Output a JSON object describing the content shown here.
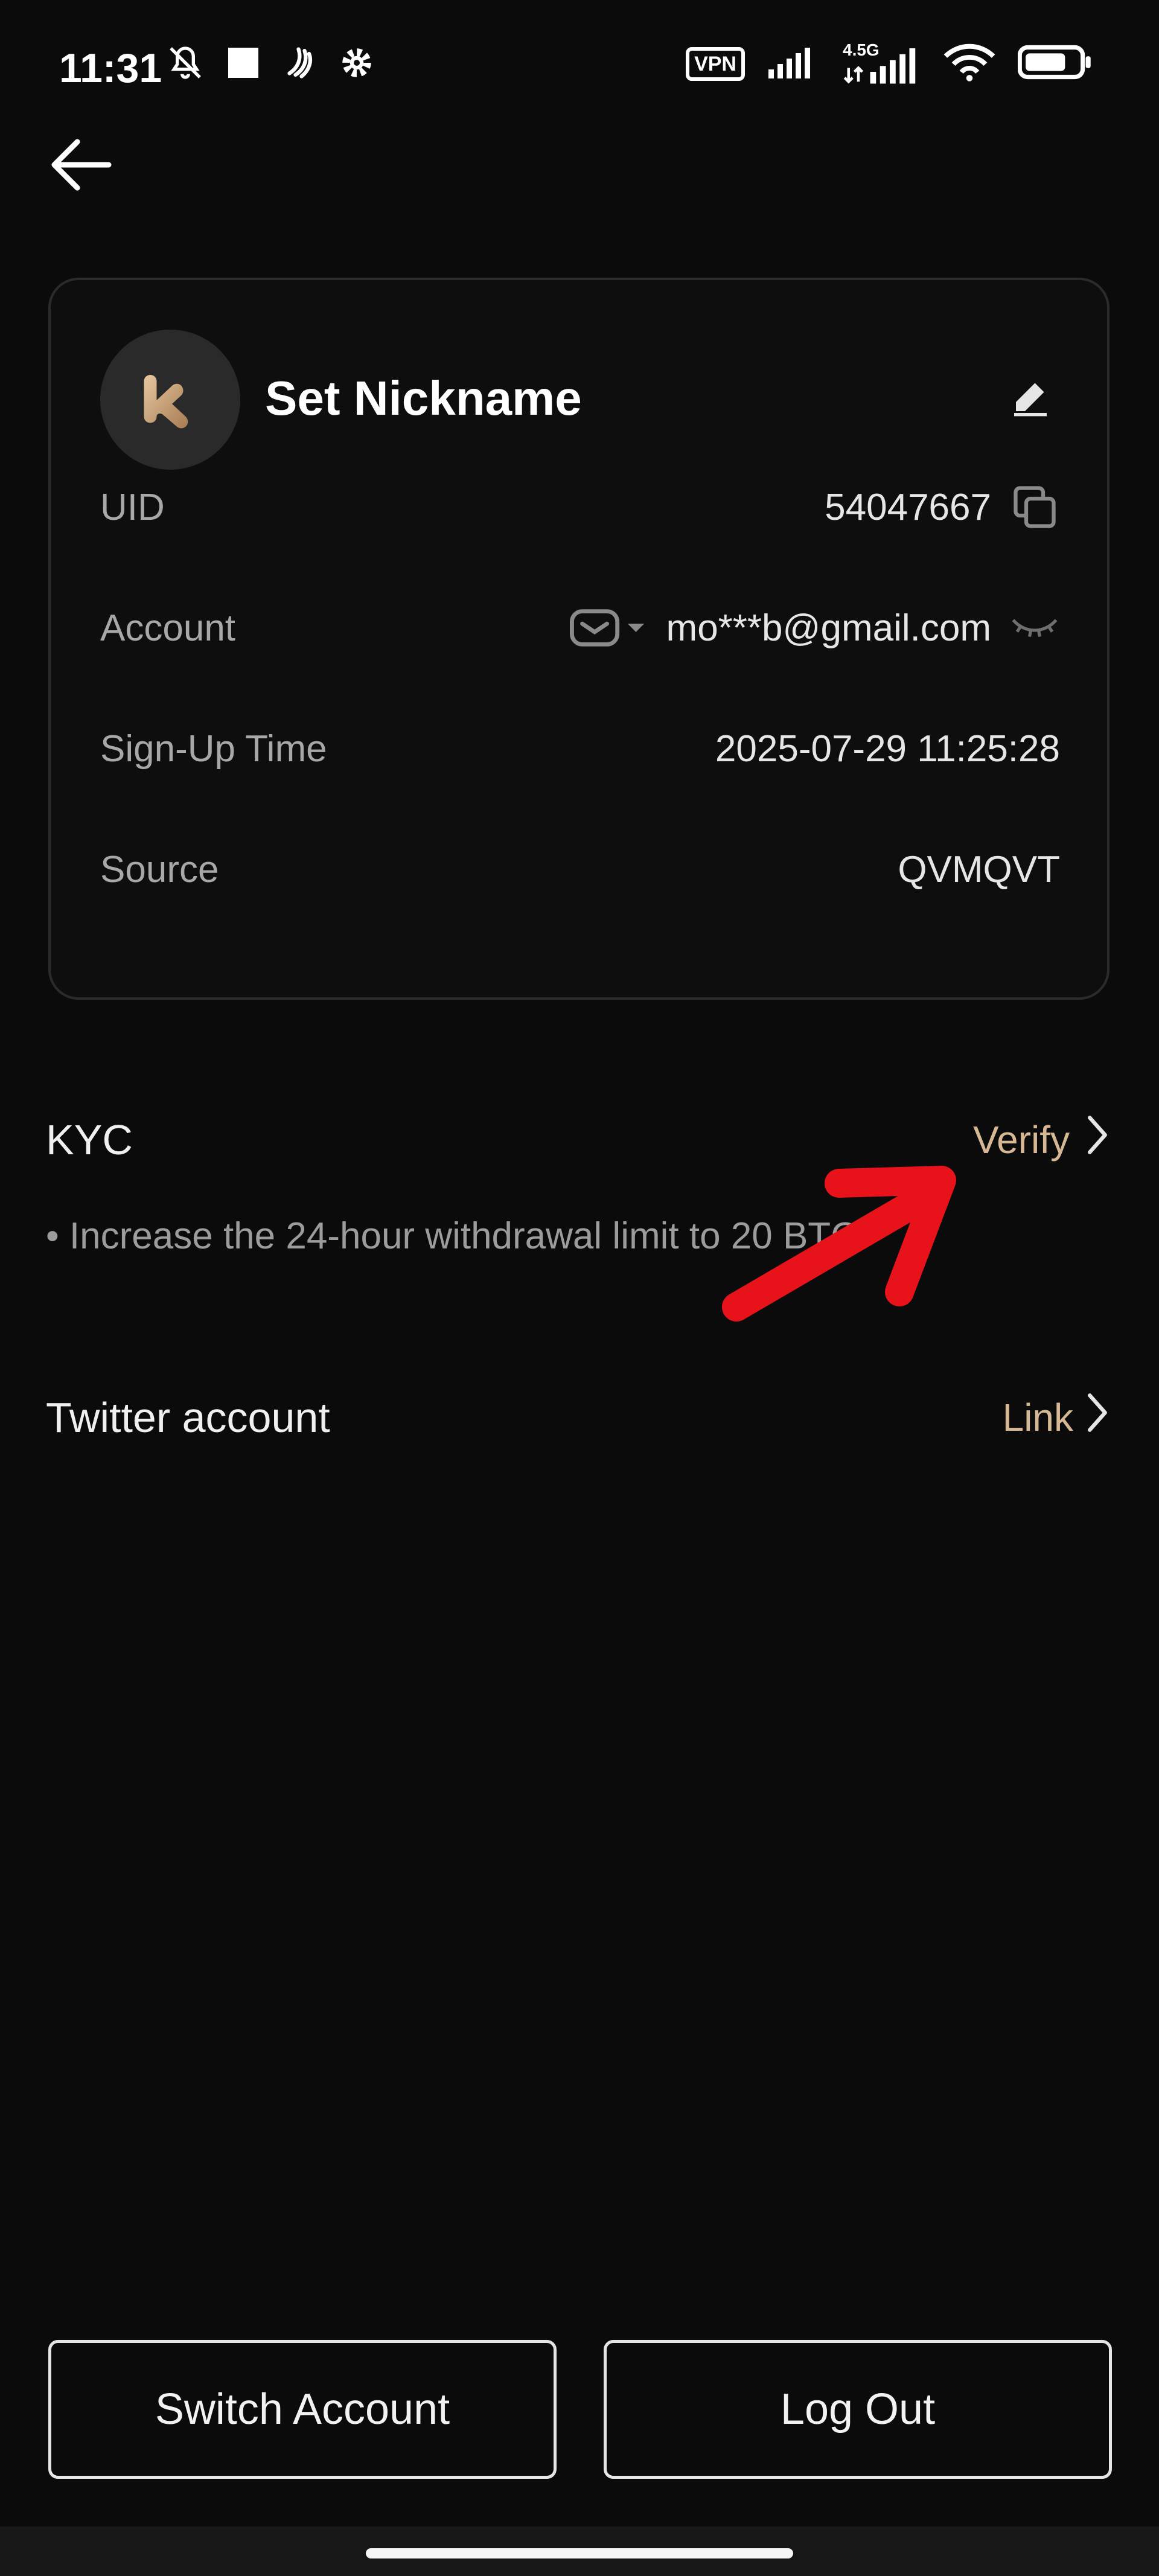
{
  "status_bar": {
    "time": "11:31",
    "vpn_label": "VPN",
    "network_label": "4.5G",
    "icons": [
      "bell-off-icon",
      "square-icon",
      "nfc-icon",
      "settings-icon",
      "vpn-icon",
      "signal-icon",
      "signal-4-5g-icon",
      "wifi-icon",
      "battery-icon"
    ]
  },
  "profile": {
    "nickname": "Set Nickname",
    "rows": [
      {
        "label": "UID",
        "value": "54047667"
      },
      {
        "label": "Account",
        "value": "mo***b@gmail.com"
      },
      {
        "label": "Sign-Up Time",
        "value": "2025-07-29 11:25:28"
      },
      {
        "label": "Source",
        "value": "QVMQVT"
      }
    ]
  },
  "kyc": {
    "title": "KYC",
    "action": "Verify",
    "note": "• Increase the 24-hour withdrawal limit to 20 BTC."
  },
  "twitter": {
    "title": "Twitter account",
    "action": "Link"
  },
  "buttons": {
    "switch_account": "Switch Account",
    "log_out": "Log Out"
  },
  "colors": {
    "background": "#0b0b0b",
    "accent": "#d7b894",
    "annotation": "#e8121b"
  }
}
